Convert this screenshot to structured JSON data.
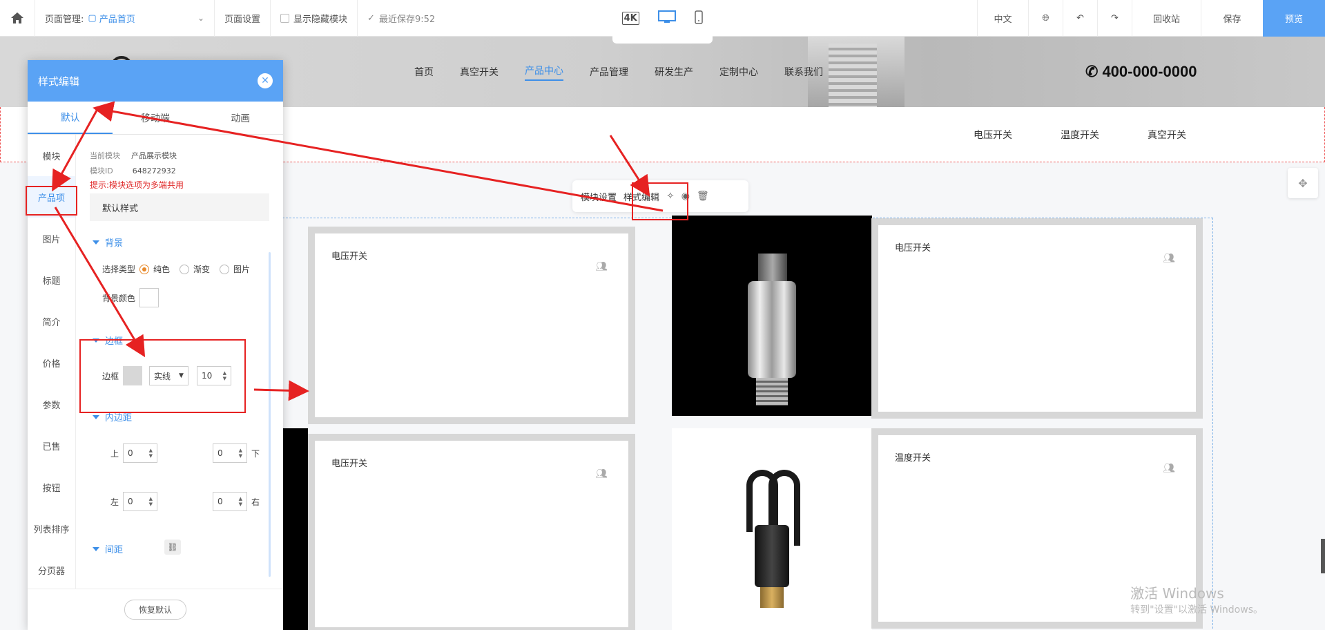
{
  "topbar": {
    "page_mgmt_label": "页面管理:",
    "current_page": "产品首页",
    "page_settings": "页面设置",
    "show_hidden": "显示隐藏模块",
    "last_saved": "最近保存9:52",
    "device_4k": "4K",
    "lang": "中文",
    "recycle": "回收站",
    "save": "保存",
    "preview": "预览"
  },
  "site": {
    "nav": [
      "首页",
      "真空开关",
      "产品中心",
      "产品管理",
      "研发生产",
      "定制中心",
      "联系我们"
    ],
    "nav_active_index": 2,
    "phone": "400-000-0000",
    "subnav": [
      "电压开关",
      "温度开关",
      "真空开关"
    ]
  },
  "module_toolbar": {
    "settings": "模块设置",
    "style_edit": "样式编辑"
  },
  "products": [
    {
      "title": "电压开关"
    },
    {
      "title": "电压开关"
    },
    {
      "title": "电压开关"
    },
    {
      "title": "温度开关"
    }
  ],
  "panel": {
    "title": "样式编辑",
    "tabs": [
      "默认",
      "移动端",
      "动画"
    ],
    "active_tab": 0,
    "side_menu": [
      "模块",
      "产品项",
      "图片",
      "标题",
      "简介",
      "价格",
      "参数",
      "已售",
      "按钮",
      "列表排序",
      "分页器"
    ],
    "active_side": 1,
    "current_module_label": "当前模块",
    "current_module_value": "产品展示模块",
    "module_id_label": "模块ID",
    "module_id_value": "648272932",
    "warning": "提示:模块选项为多端共用",
    "default_style": "默认样式",
    "background_section": "背景",
    "select_type_label": "选择类型",
    "type_options": [
      "纯色",
      "渐变",
      "图片"
    ],
    "type_selected": "纯色",
    "bg_color_label": "背景颜色",
    "border_section": "边框",
    "border_label": "边框",
    "border_color": "#d7d7d7",
    "border_style": "实线",
    "border_width": "10",
    "padding_section": "内边距",
    "pad_top_label": "上",
    "pad_bottom_label": "下",
    "pad_left_label": "左",
    "pad_right_label": "右",
    "pad_top": "0",
    "pad_bottom": "0",
    "pad_left": "0",
    "pad_right": "0",
    "spacing_section": "间距",
    "reset": "恢复默认"
  },
  "watermark": {
    "line1": "激活 Windows",
    "line2": "转到\"设置\"以激活 Windows。"
  },
  "colors": {
    "accent": "#3d8fe8",
    "panel_header": "#5aa3f5",
    "annotation": "#e62222"
  }
}
